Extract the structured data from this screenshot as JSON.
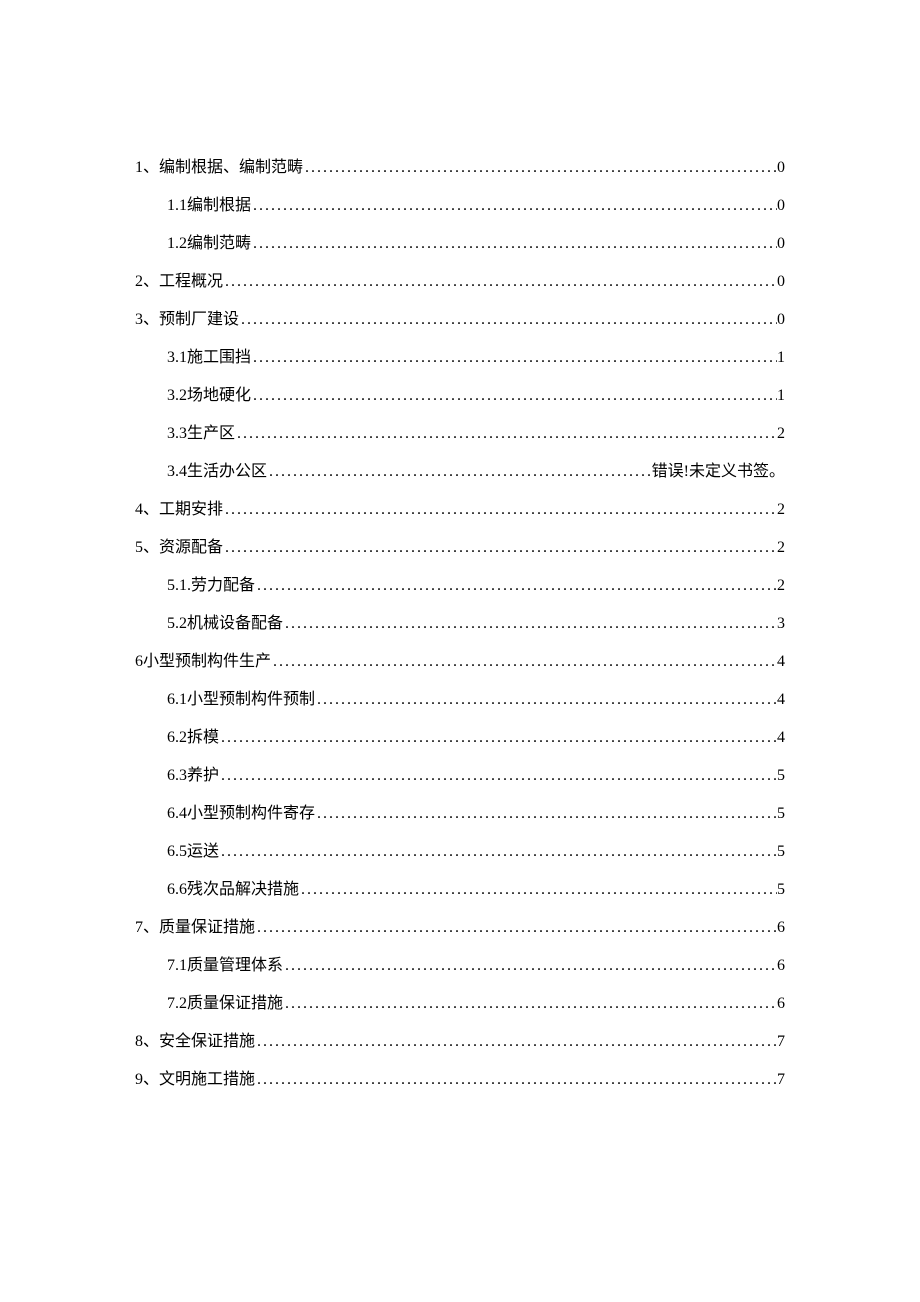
{
  "toc": [
    {
      "level": 1,
      "label": "1、编制根据、编制范畴",
      "page": "0"
    },
    {
      "level": 2,
      "label": "1.1编制根据",
      "page": "0"
    },
    {
      "level": 2,
      "label": "1.2编制范畴",
      "page": "0"
    },
    {
      "level": 1,
      "label": "2、工程概况",
      "page": "0"
    },
    {
      "level": 1,
      "label": "3、预制厂建设",
      "page": "0"
    },
    {
      "level": 2,
      "label": "3.1施工围挡",
      "page": "1"
    },
    {
      "level": 2,
      "label": "3.2场地硬化",
      "page": "1"
    },
    {
      "level": 2,
      "label": "3.3生产区",
      "page": "2"
    },
    {
      "level": 2,
      "label": "3.4生活办公区",
      "page": "错误!未定义书签。"
    },
    {
      "level": 1,
      "label": "4、工期安排",
      "page": "2"
    },
    {
      "level": 1,
      "label": "5、资源配备",
      "page": "2"
    },
    {
      "level": 2,
      "label": "5.1.劳力配备",
      "page": "2"
    },
    {
      "level": 2,
      "label": "5.2机械设备配备",
      "page": "3"
    },
    {
      "level": 1,
      "label": "6小型预制构件生产",
      "page": "4"
    },
    {
      "level": 2,
      "label": "6.1小型预制构件预制",
      "page": "4"
    },
    {
      "level": 2,
      "label": "6.2拆模",
      "page": "4"
    },
    {
      "level": 2,
      "label": "6.3养护",
      "page": "5"
    },
    {
      "level": 2,
      "label": "6.4小型预制构件寄存",
      "page": "5"
    },
    {
      "level": 2,
      "label": "6.5运送",
      "page": "5"
    },
    {
      "level": 2,
      "label": "6.6残次品解决措施",
      "page": "5"
    },
    {
      "level": 1,
      "label": "7、质量保证措施",
      "page": "6"
    },
    {
      "level": 2,
      "label": "7.1质量管理体系",
      "page": "6"
    },
    {
      "level": 2,
      "label": "7.2质量保证措施",
      "page": "6"
    },
    {
      "level": 1,
      "label": "8、安全保证措施",
      "page": "7"
    },
    {
      "level": 1,
      "label": "9、文明施工措施",
      "page": "7"
    }
  ]
}
